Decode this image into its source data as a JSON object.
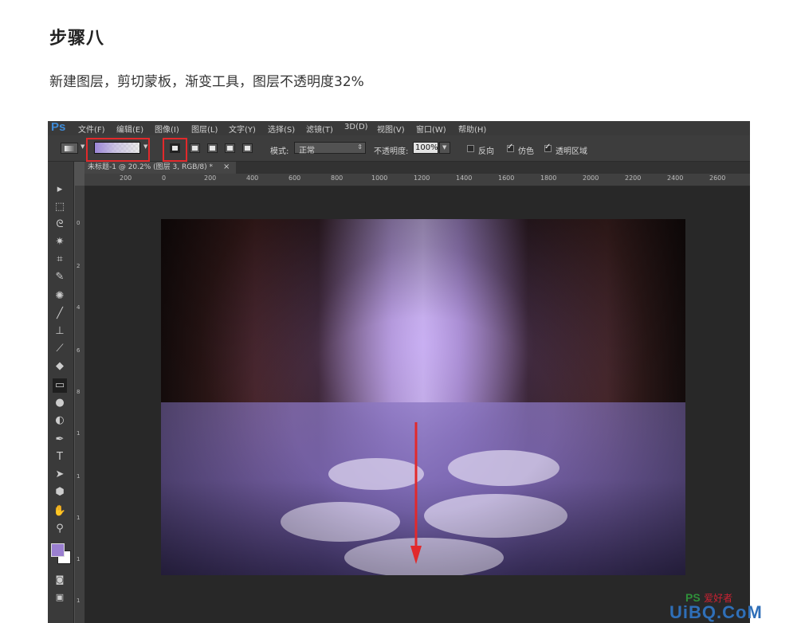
{
  "article": {
    "heading": "步骤八",
    "description": "新建图层，剪切蒙板，渐变工具，图层不透明度32%"
  },
  "app": {
    "logo": "Ps",
    "menu": [
      "文件(F)",
      "编辑(E)",
      "图像(I)",
      "图层(L)",
      "文字(Y)",
      "选择(S)",
      "滤镜(T)",
      "3D(D)",
      "视图(V)",
      "窗口(W)",
      "帮助(H)"
    ]
  },
  "options": {
    "mode_label": "模式:",
    "mode_value": "正常",
    "opacity_label": "不透明度:",
    "opacity_value": "100%",
    "reverse_label": "反向",
    "dither_label": "仿色",
    "transparency_label": "透明区域",
    "reverse_checked": false,
    "dither_checked": true,
    "transparency_checked": true,
    "gradient_colors": [
      "#9b86d6",
      "transparent"
    ]
  },
  "document": {
    "tab_label": "未标题-1 @ 20.2% (图层 3, RGB/8) *",
    "tab_close": "×"
  },
  "ruler": {
    "top_ticks": [
      "200",
      "0",
      "200",
      "400",
      "600",
      "800",
      "1000",
      "1200",
      "1400",
      "1600",
      "1800",
      "2000",
      "2200",
      "2400",
      "2600"
    ],
    "left_ticks": [
      "0",
      "2",
      "4",
      "6",
      "8",
      "1",
      "1",
      "1",
      "1",
      "1"
    ]
  },
  "colors": {
    "foreground": "#9a7fd0",
    "background": "#ffffff",
    "highlight_box": "#e2292b",
    "arrow": "#e2292b"
  },
  "watermark": {
    "ps_text": "PS",
    "brand_text": "爱好者",
    "site_text": "UiBQ.CoM"
  }
}
